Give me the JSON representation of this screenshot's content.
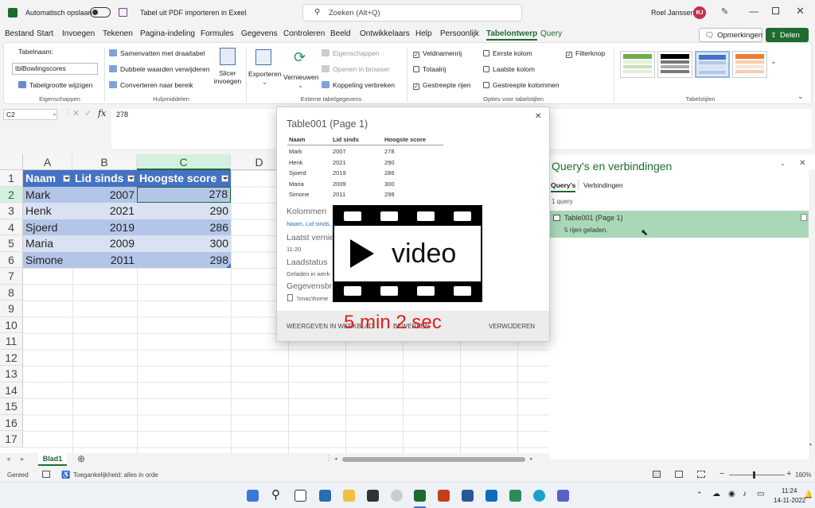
{
  "titlebar": {
    "autosave_label": "Automatisch opslaan",
    "doc_title": "Tabel uit PDF importeren in Excel",
    "search_placeholder": "Zoeken (Alt+Q)",
    "user_name": "Roel Janssen",
    "user_initials": "RJ"
  },
  "menu": {
    "items": [
      "Bestand",
      "Start",
      "Invoegen",
      "Tekenen",
      "Pagina-indeling",
      "Formules",
      "Gegevens",
      "Controleren",
      "Beeld",
      "Ontwikkelaars",
      "Help",
      "Persoonlijk",
      "Tabelontwerp",
      "Query"
    ],
    "active": "Tabelontwerp",
    "comments_label": "Opmerkingen",
    "share_label": "Delen"
  },
  "ribbon": {
    "props": {
      "table_name_label": "Tabelnaam:",
      "table_name_value": "tblBowlingscores",
      "resize_label": "Tabelgrootte wijzigen",
      "group": "Eigenschappen"
    },
    "tools": {
      "pivot": "Samenvatten met draaitabel",
      "dedupe": "Dubbele waarden verwijderen",
      "convert": "Converteren naar bereik",
      "slicer": "Slicer invoegen",
      "group": "Hulpmiddelen"
    },
    "external": {
      "export": "Exporteren",
      "refresh": "Vernieuwen",
      "properties": "Eigenschappen",
      "open_browser": "Openen in browser",
      "unlink": "Koppeling verbreken",
      "group": "Externe tabelgegevens"
    },
    "options": {
      "header_row": "Veldnamenrij",
      "total_row": "Totaalrij",
      "banded_rows": "Gestreepte rijen",
      "first_col": "Eerste kolom",
      "last_col": "Laatste kolom",
      "banded_cols": "Gestreepte kolommen",
      "filter_btn": "Filterknop",
      "group": "Opties voor tabelstijlen"
    },
    "styles_group": "Tabelstijlen"
  },
  "formula": {
    "namebox": "C2",
    "fx": "fx",
    "value": "278"
  },
  "grid": {
    "columns": [
      "A",
      "B",
      "C",
      "D"
    ],
    "rows": [
      "1",
      "2",
      "3",
      "4",
      "5",
      "6",
      "7",
      "8",
      "9",
      "10",
      "11",
      "12",
      "13",
      "14",
      "15",
      "16",
      "17"
    ],
    "headers": [
      "Naam",
      "Lid sinds",
      "Hoogste score"
    ],
    "data": [
      [
        "Mark",
        "2007",
        "278"
      ],
      [
        "Henk",
        "2021",
        "290"
      ],
      [
        "Sjoerd",
        "2019",
        "286"
      ],
      [
        "Maria",
        "2009",
        "300"
      ],
      [
        "Simone",
        "2011",
        "298"
      ]
    ]
  },
  "sheets": {
    "active": "Blad1"
  },
  "status": {
    "ready": "Gereed",
    "accessibility": "Toegankelijkheid: alles in orde",
    "zoom": "160%"
  },
  "popup": {
    "title": "Table001 (Page 1)",
    "headers": [
      "Naam",
      "Lid sinds",
      "Hoogste score"
    ],
    "rows": [
      [
        "Mark",
        "2007",
        "278"
      ],
      [
        "Henk",
        "2021",
        "290"
      ],
      [
        "Sjoerd",
        "2019",
        "286"
      ],
      [
        "Maria",
        "2009",
        "300"
      ],
      [
        "Simone",
        "2011",
        "298"
      ]
    ],
    "columns_title": "Kolommen",
    "columns_value": "Naam, Lid sinds,",
    "refreshed_title": "Laatst vernie",
    "refreshed_value": "11:20",
    "load_title": "Laadstatus",
    "load_value": "Geladen in werk",
    "source_title": "Gegevensbr",
    "source_value": "\\\\mac\\home",
    "view_btn": "WEERGEVEN IN WERKBLAD",
    "edit_btn": "BEWERKEN",
    "delete_btn": "VERWIJDEREN"
  },
  "video": {
    "label": "video",
    "duration": "5 min 2 sec"
  },
  "queries": {
    "title": "Query's en verbindingen",
    "tab_queries": "Query's",
    "tab_connections": "Verbindingen",
    "count": "1 query",
    "item_name": "Table001 (Page 1)",
    "item_status": "5 rijen geladen."
  },
  "taskbar": {
    "time": "11:24",
    "date": "14-11-2022"
  },
  "colors": {
    "excel_green": "#1e6b2f",
    "table_header": "#4472c4",
    "band_dark": "#b4c6e7",
    "band_light": "#d9e1f2",
    "query_selected": "#a9d8b8",
    "video_red": "#e0201c"
  }
}
